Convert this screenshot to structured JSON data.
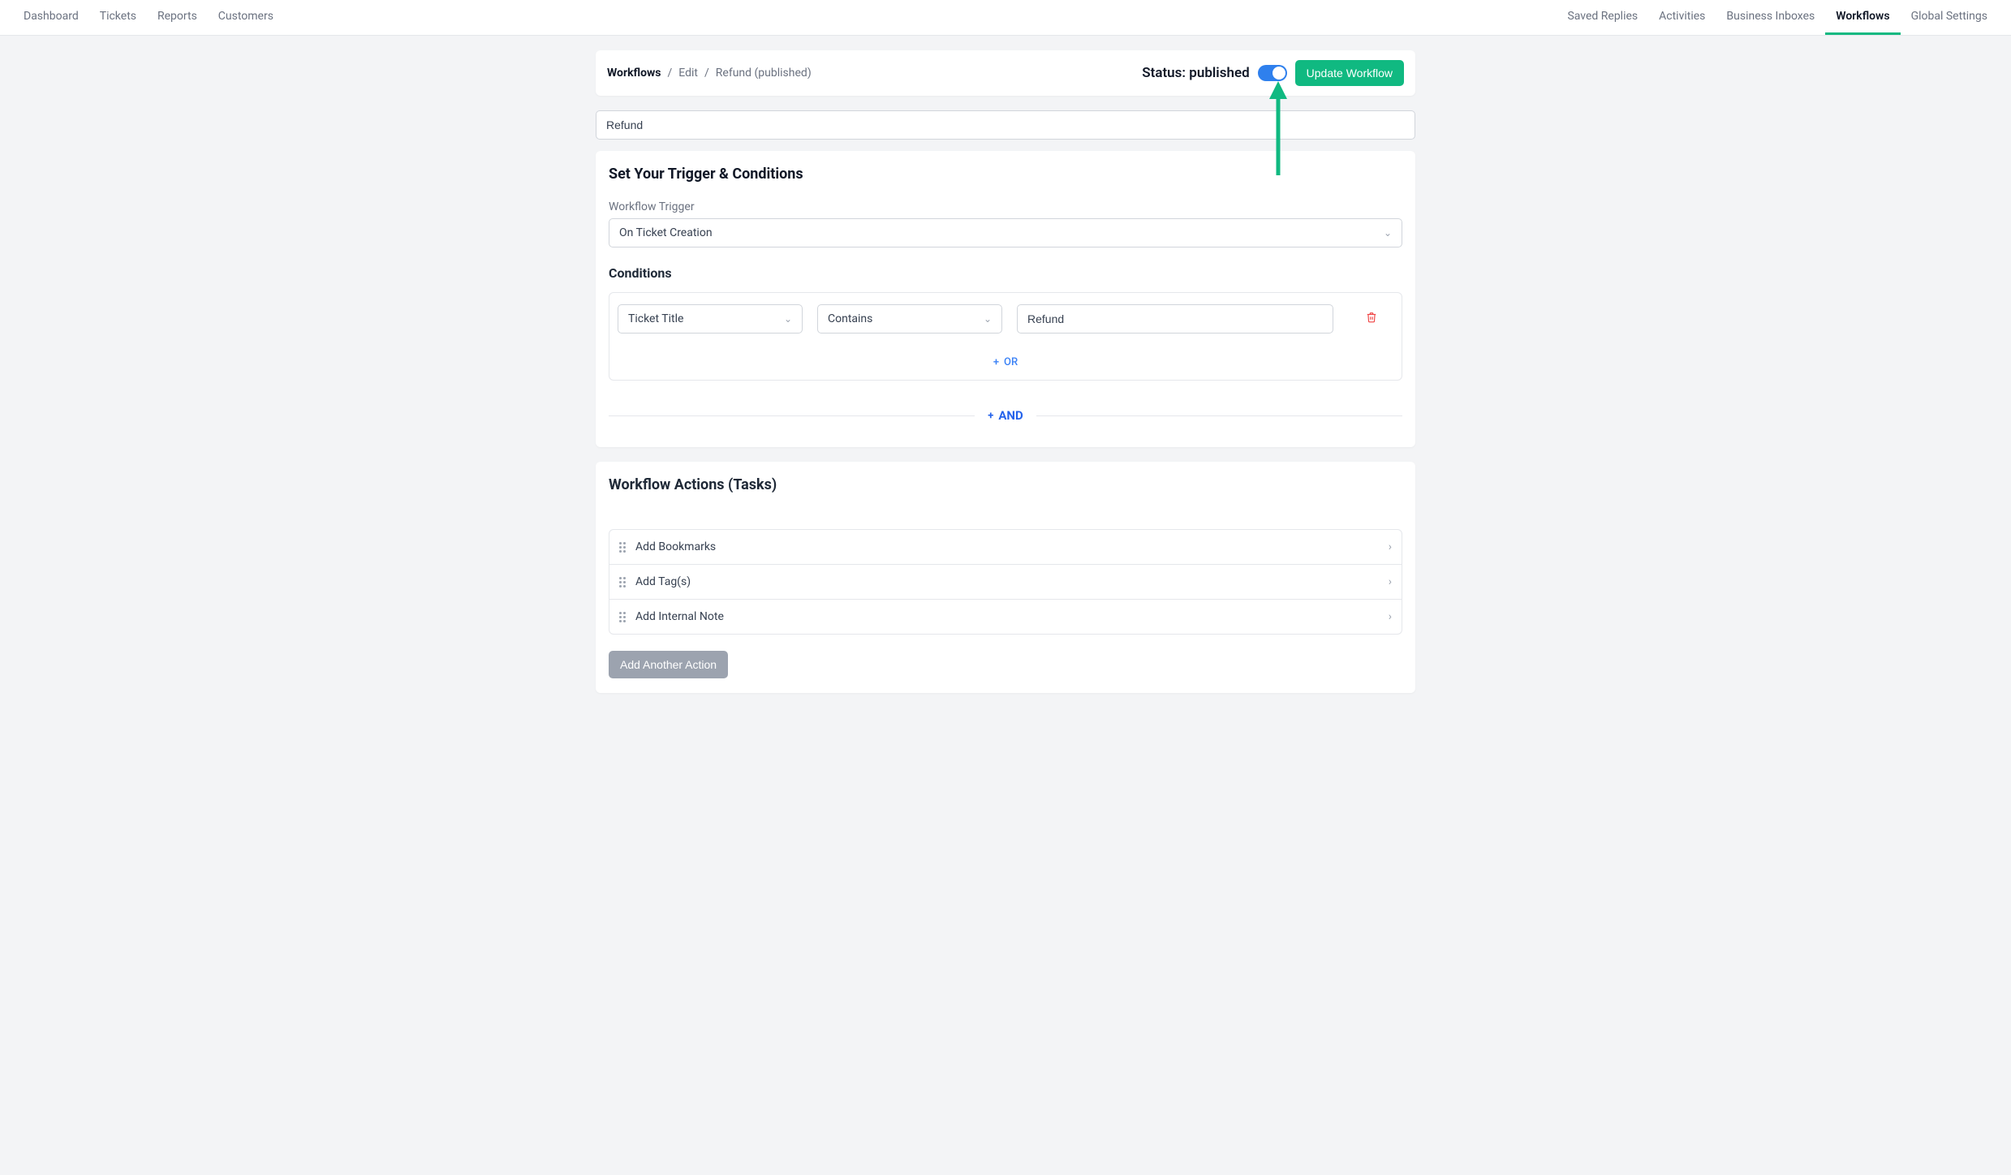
{
  "nav": {
    "left": [
      "Dashboard",
      "Tickets",
      "Reports",
      "Customers"
    ],
    "right": [
      "Saved Replies",
      "Activities",
      "Business Inboxes",
      "Workflows",
      "Global Settings"
    ],
    "active": "Workflows"
  },
  "breadcrumb": {
    "root": "Workflows",
    "edit": "Edit",
    "item": "Refund (published)"
  },
  "header": {
    "status_label": "Status: published",
    "update_button": "Update Workflow"
  },
  "workflow_name": {
    "value": "Refund"
  },
  "triggers_section": {
    "title": "Set Your Trigger & Conditions",
    "trigger_label": "Workflow Trigger",
    "trigger_value": "On Ticket Creation",
    "conditions_label": "Conditions",
    "condition": {
      "field": "Ticket Title",
      "operator": "Contains",
      "value": "Refund"
    },
    "or_label": "OR",
    "and_label": "AND"
  },
  "actions_section": {
    "title": "Workflow Actions (Tasks)",
    "items": [
      "Add Bookmarks",
      "Add Tag(s)",
      "Add Internal Note"
    ],
    "add_button": "Add Another Action"
  }
}
